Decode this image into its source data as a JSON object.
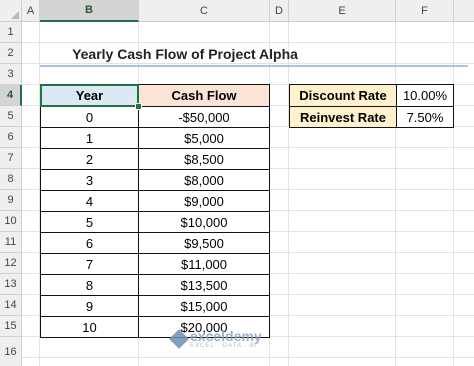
{
  "columns": [
    "A",
    "B",
    "C",
    "D",
    "E",
    "F"
  ],
  "active_column": "B",
  "rows": [
    "1",
    "2",
    "3",
    "4",
    "5",
    "6",
    "7",
    "8",
    "9",
    "10",
    "11",
    "12",
    "13",
    "14",
    "15",
    "16"
  ],
  "active_row": "4",
  "title": "Yearly Cash Flow of Project Alpha",
  "table": {
    "headers": [
      "Year",
      "Cash Flow"
    ],
    "rows": [
      [
        "0",
        "-$50,000"
      ],
      [
        "1",
        "$5,000"
      ],
      [
        "2",
        "$8,500"
      ],
      [
        "3",
        "$8,000"
      ],
      [
        "4",
        "$9,000"
      ],
      [
        "5",
        "$10,000"
      ],
      [
        "6",
        "$9,500"
      ],
      [
        "7",
        "$11,000"
      ],
      [
        "8",
        "$13,500"
      ],
      [
        "9",
        "$15,000"
      ],
      [
        "10",
        "$20,000"
      ]
    ]
  },
  "rates": [
    {
      "label": "Discount Rate",
      "value": "10.00%"
    },
    {
      "label": "Reinvest Rate",
      "value": "7.50%"
    }
  ],
  "watermark": {
    "name": "exceldemy",
    "tagline": "EXCEL · DATA · BI"
  },
  "colors": {
    "year_header": "#dbe9f5",
    "cashflow_header": "#fbe3d6",
    "rate_label": "#fff1cc",
    "selection": "#217346"
  }
}
